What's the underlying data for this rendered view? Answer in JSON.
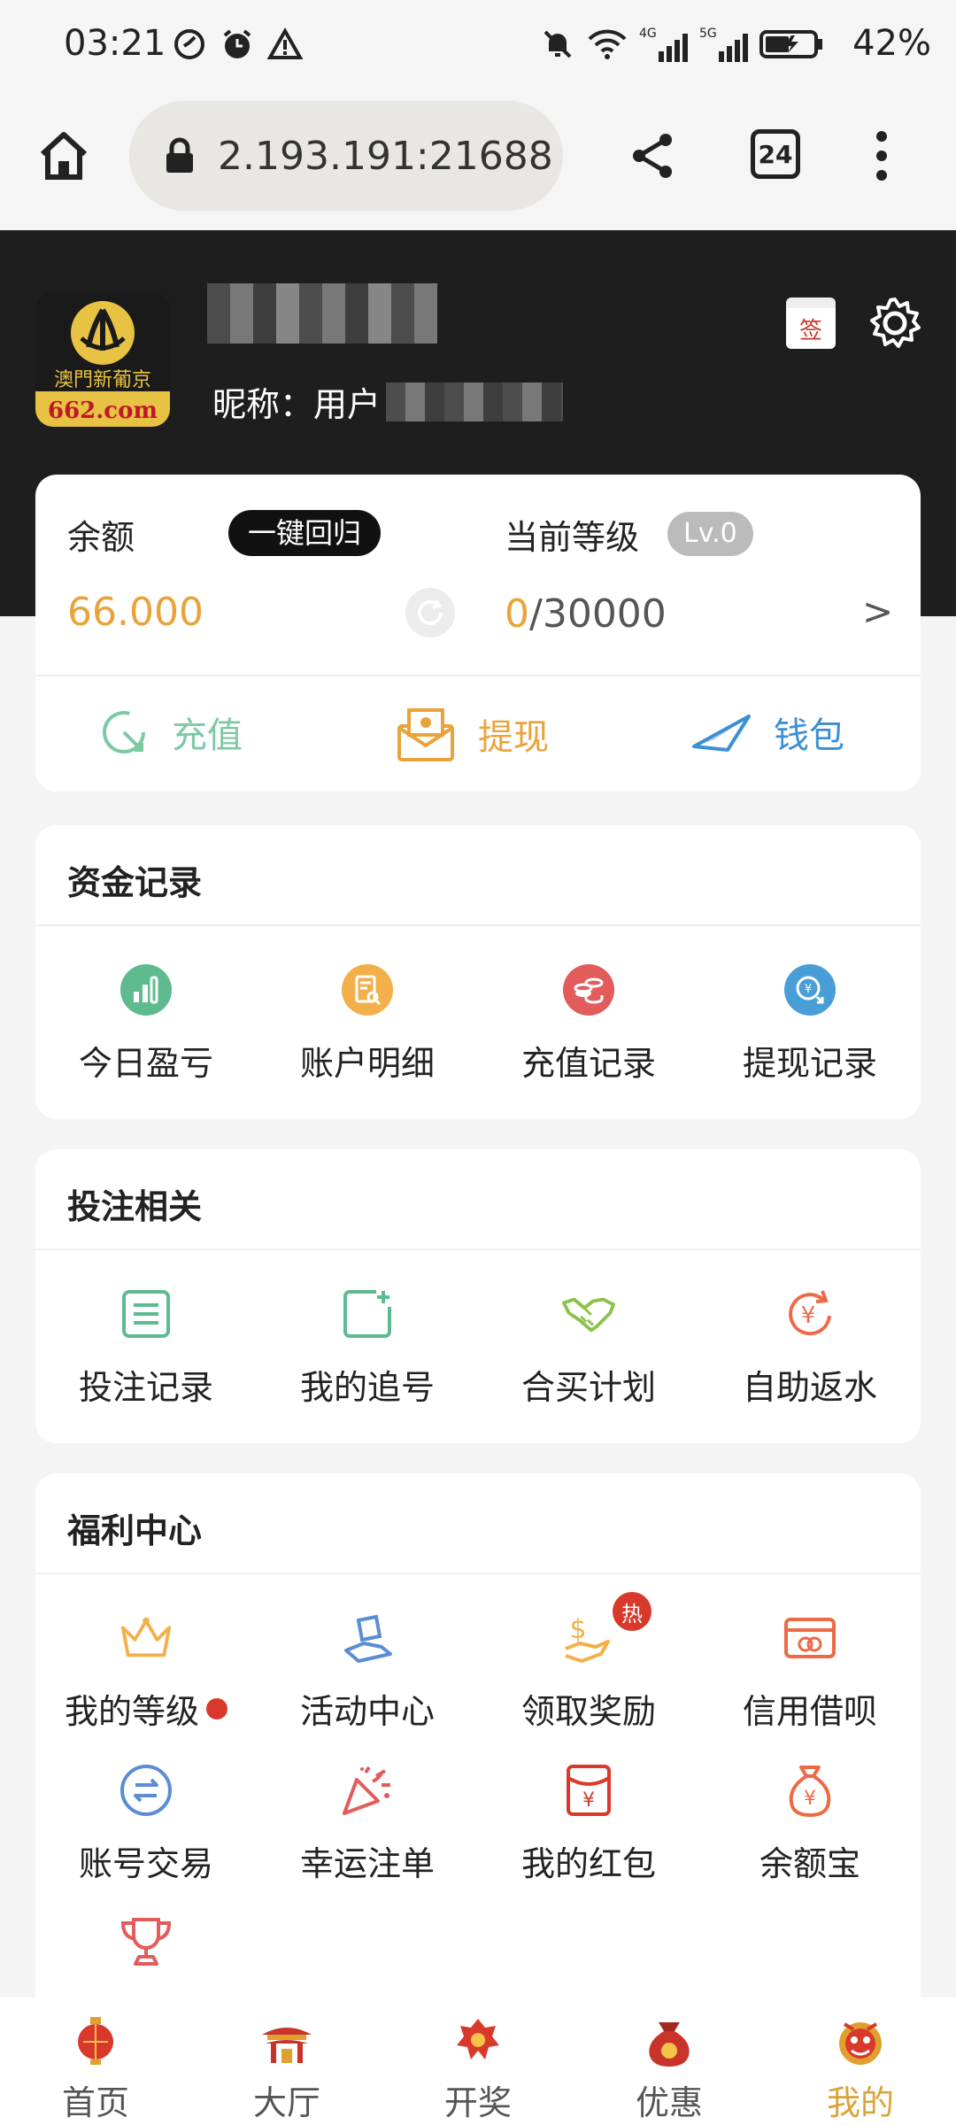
{
  "status_bar": {
    "time": "03:21",
    "battery": "42%"
  },
  "browser": {
    "url": "2.193.191:21688",
    "tab_count": "24"
  },
  "profile": {
    "logo_text_top": "澳門新葡京",
    "logo_text_bottom": "662.com",
    "nickname_label": "昵称：用户",
    "sign_label": "签"
  },
  "balance": {
    "label": "余额",
    "return_button": "一键回归",
    "value": "66.000",
    "level_label": "当前等级",
    "level_badge": "Lv.0",
    "level_current": "0",
    "level_target": "/30000",
    "arrow": ">"
  },
  "quick_actions": [
    {
      "label": "充值",
      "color": "#7cc9a4"
    },
    {
      "label": "提现",
      "color": "#e9a33a"
    },
    {
      "label": "钱包",
      "color": "#3d8fd4"
    }
  ],
  "funds": {
    "title": "资金记录",
    "items": [
      {
        "label": "今日盈亏"
      },
      {
        "label": "账户明细"
      },
      {
        "label": "充值记录"
      },
      {
        "label": "提现记录"
      }
    ]
  },
  "betting": {
    "title": "投注相关",
    "items": [
      {
        "label": "投注记录"
      },
      {
        "label": "我的追号"
      },
      {
        "label": "合买计划"
      },
      {
        "label": "自助返水"
      }
    ]
  },
  "welfare": {
    "title": "福利中心",
    "hot_badge": "热",
    "items": [
      {
        "label": "我的等级"
      },
      {
        "label": "活动中心"
      },
      {
        "label": "领取奖励"
      },
      {
        "label": "信用借呗"
      },
      {
        "label": "账号交易"
      },
      {
        "label": "幸运注单"
      },
      {
        "label": "我的红包"
      },
      {
        "label": "余额宝"
      }
    ]
  },
  "bottom_nav": [
    {
      "label": "首页"
    },
    {
      "label": "大厅"
    },
    {
      "label": "开奖"
    },
    {
      "label": "优惠"
    },
    {
      "label": "我的"
    }
  ]
}
